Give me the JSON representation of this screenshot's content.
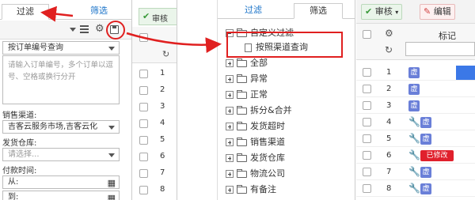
{
  "left_panel": {
    "tabs": {
      "filter": "过滤",
      "select": "筛选"
    },
    "query_select": "按订单编号查询",
    "textarea_placeholder": "请输入订单编号，多个订单以逗号、空格或换行分开",
    "channel_label": "销售渠道:",
    "channel_value": "吉客云服务市场,吉客云化",
    "warehouse_label": "发货仓库:",
    "warehouse_placeholder": "请选择...",
    "paytime_label": "付款时间:",
    "from_label": "从:",
    "to_label": "到:"
  },
  "left_grid": {
    "rows": [
      "1",
      "2",
      "3",
      "4",
      "5",
      "6",
      "7",
      "8"
    ]
  },
  "middle_panel": {
    "tabs": {
      "filter": "过滤",
      "select": "筛选"
    },
    "custom_filter": "自定义过滤",
    "child_item": "按照渠道查询",
    "tree_items": [
      "全部",
      "异常",
      "正常",
      "拆分&合并",
      "发货超时",
      "销售渠道",
      "发货仓库",
      "物流公司",
      "有备注"
    ]
  },
  "right_panel": {
    "toolbar": {
      "audit": "审核",
      "edit": "编辑"
    },
    "header": {
      "label_col": "标记"
    },
    "rows": [
      {
        "num": "1",
        "tags": [
          "虚"
        ],
        "modified": false,
        "wrench": false
      },
      {
        "num": "2",
        "tags": [
          "虚"
        ],
        "modified": false,
        "wrench": false
      },
      {
        "num": "3",
        "tags": [
          "虚"
        ],
        "modified": false,
        "wrench": false
      },
      {
        "num": "4",
        "tags": [
          "虚"
        ],
        "modified": false,
        "wrench": true
      },
      {
        "num": "5",
        "tags": [
          "虚"
        ],
        "modified": false,
        "wrench": true
      },
      {
        "num": "6",
        "tags": [],
        "modified": true,
        "wrench": true
      },
      {
        "num": "7",
        "tags": [
          "虚"
        ],
        "modified": false,
        "wrench": true
      },
      {
        "num": "8",
        "tags": [
          "虚"
        ],
        "modified": false,
        "wrench": true
      }
    ],
    "modified_label": "已修改",
    "virtual_tag": "虚"
  },
  "colors": {
    "accent_blue": "#1a73c9",
    "annotation_red": "#e02020",
    "tag_blue": "#6a7fd8",
    "tag_red": "#e0202c",
    "wrench_orange": "#f39a1e",
    "audit_green": "#3a9a3a"
  }
}
